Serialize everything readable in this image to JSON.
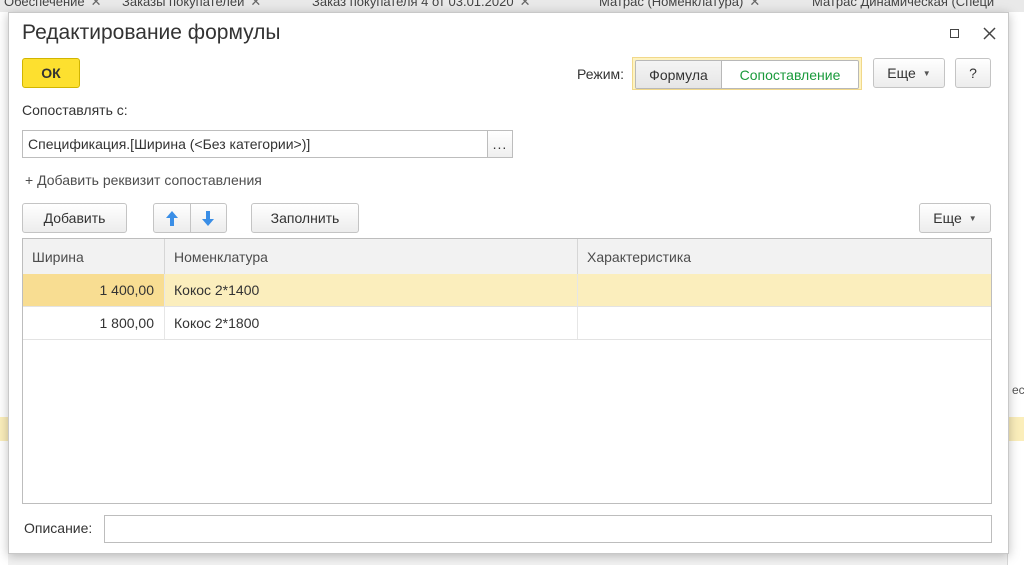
{
  "background_tabs": [
    {
      "label": "Обеспечение"
    },
    {
      "label": "Заказы покупателей"
    },
    {
      "label": "Заказ покупателя 4 от 03.01.2020"
    },
    {
      "label": "Матрас (Номенклатура)"
    },
    {
      "label": "Матрас Динамическая (Специ"
    }
  ],
  "dialog": {
    "title": "Редактирование формулы",
    "ok_label": "ОК",
    "mode_label": "Режим:",
    "mode_options": [
      "Формула",
      "Сопоставление"
    ],
    "mode_selected": "Сопоставление",
    "more_label": "Еще",
    "help_label": "?",
    "match_with_label": "Сопоставлять с:",
    "match_with_value": "Спецификация.[Ширина (<Без категории>)]",
    "choose_button_label": "...",
    "add_attribute_link": "+ Добавить реквизит сопоставления"
  },
  "table_toolbar": {
    "add_label": "Добавить",
    "fill_label": "Заполнить",
    "more_label": "Еще"
  },
  "table": {
    "columns": [
      "Ширина",
      "Номенклатура",
      "Характеристика"
    ],
    "rows": [
      {
        "width": "1 400,00",
        "nomenclature": "Кокос 2*1400",
        "characteristic": "",
        "selected": true
      },
      {
        "width": "1 800,00",
        "nomenclature": "Кокос 2*1800",
        "characteristic": "",
        "selected": false
      }
    ]
  },
  "description": {
    "label": "Описание:",
    "value": ""
  },
  "background_right": {
    "text": "ес"
  },
  "colors": {
    "ok_button": "#fde02f",
    "mode_selected_text": "#199a3b",
    "selected_row": "#fbeebd",
    "arrow_icons": "#3a8ee6"
  }
}
